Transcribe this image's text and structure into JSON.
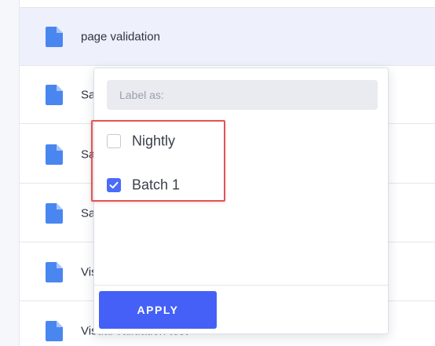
{
  "file_list": {
    "rows": [
      {
        "label": "",
        "selected": false
      },
      {
        "label": "page validation",
        "selected": true
      },
      {
        "label": "Sa",
        "selected": false
      },
      {
        "label": "Sa",
        "selected": false
      },
      {
        "label": "Sa",
        "selected": false
      },
      {
        "label": "Visu",
        "selected": false
      },
      {
        "label": "Visual validation test",
        "selected": false
      }
    ]
  },
  "label_dropdown": {
    "input": {
      "placeholder": "Label as:",
      "value": ""
    },
    "options": [
      {
        "label": "Nightly",
        "checked": false
      },
      {
        "label": "Batch 1",
        "checked": true
      }
    ],
    "apply_label": "APPLY"
  },
  "colors": {
    "accent": "#4460f6",
    "checkbox_checked": "#4a6cf7",
    "file_icon": "#4a86f0",
    "highlight": "#e05555",
    "selected_row": "#eef1fb"
  },
  "icons": {
    "file": "file-icon",
    "check": "check-icon"
  }
}
